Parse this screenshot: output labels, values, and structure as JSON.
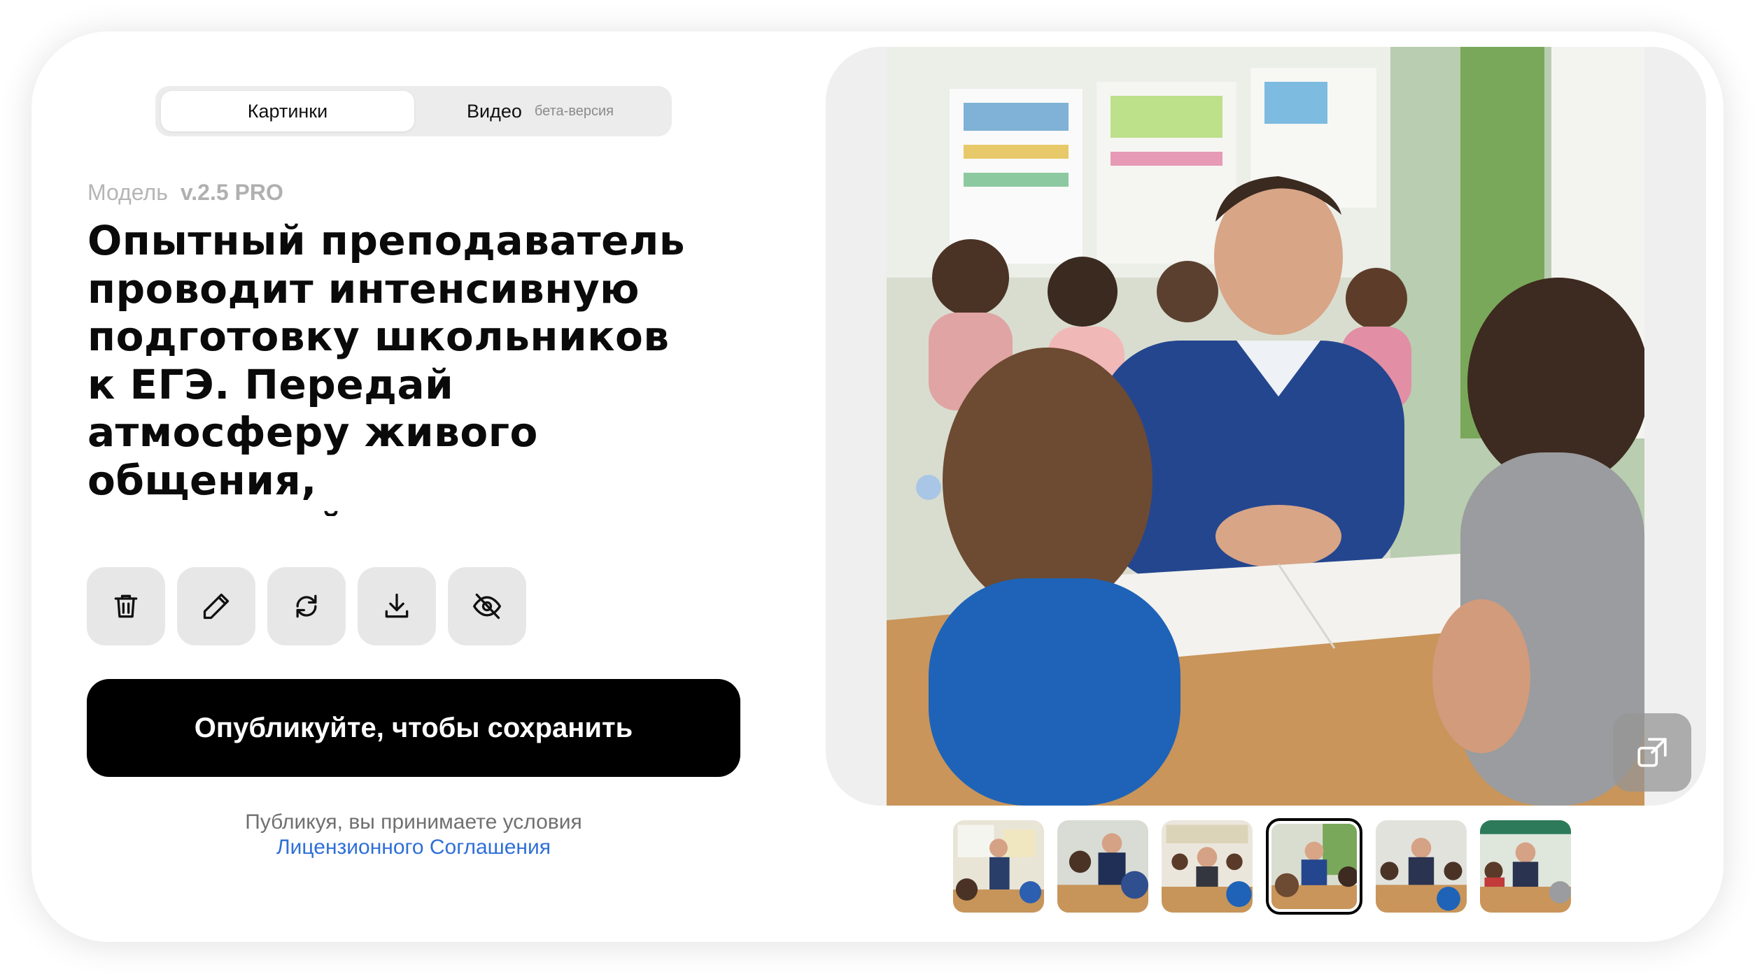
{
  "tabs": {
    "images_label": "Картинки",
    "video_label": "Видео",
    "video_badge": "бета-версия"
  },
  "model": {
    "label": "Модель",
    "version": "v.2.5 PRO"
  },
  "prompt": {
    "text": "Опытный преподаватель проводит интенсивную подготовку школьников к ЕГЭ. Передай атмосферу живого общения, взаимодействия с учащейся"
  },
  "toolbar": {
    "icons": [
      "trash-icon",
      "pencil-icon",
      "refresh-icon",
      "download-icon",
      "eye-off-icon"
    ]
  },
  "publish": {
    "button_label": "Опубликуйте, чтобы сохранить",
    "terms_text": "Публикуя, вы принимаете условия",
    "terms_link": "Лицензионного Соглашения"
  },
  "gallery": {
    "thumbnail_count": 6,
    "selected_index": 4,
    "expand_icon": "expand-icon"
  },
  "colors": {
    "accent_link": "#2f6fd8",
    "primary_button": "#000000",
    "tool_button_bg": "#e7e7e7"
  }
}
